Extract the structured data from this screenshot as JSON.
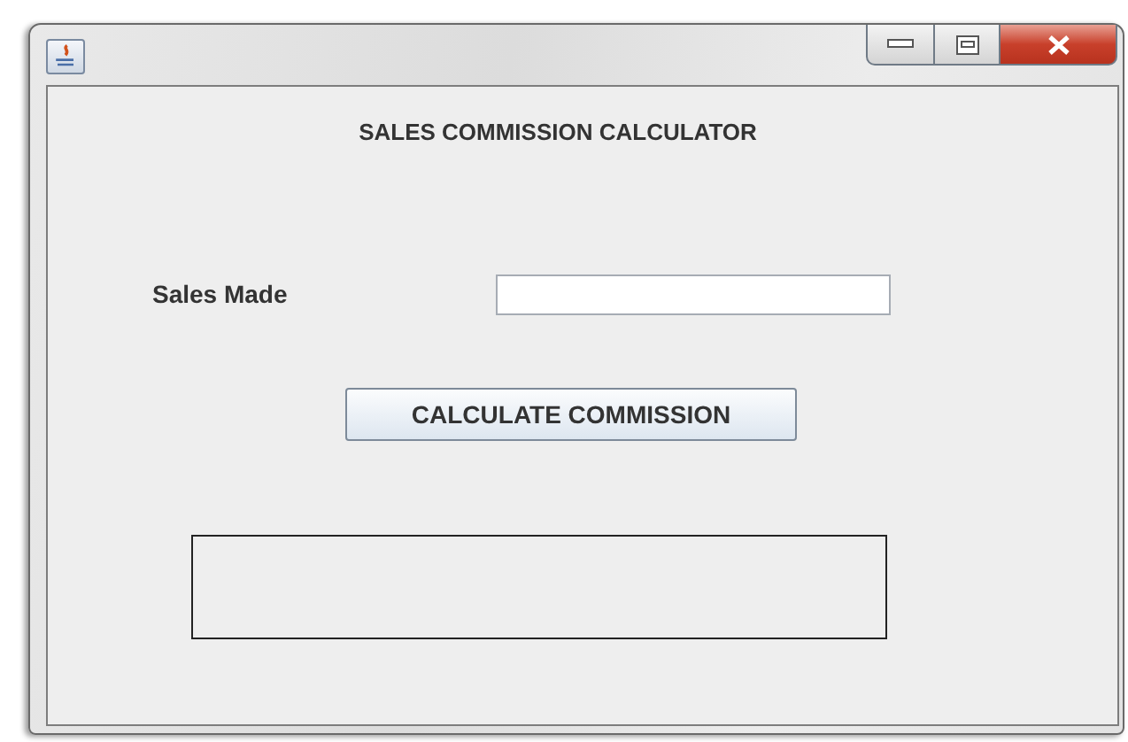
{
  "heading": "SALES COMMISSION CALCULATOR",
  "sales_field": {
    "label": "Sales Made"
  },
  "button": {
    "label": "CALCULATE COMMISSION"
  }
}
